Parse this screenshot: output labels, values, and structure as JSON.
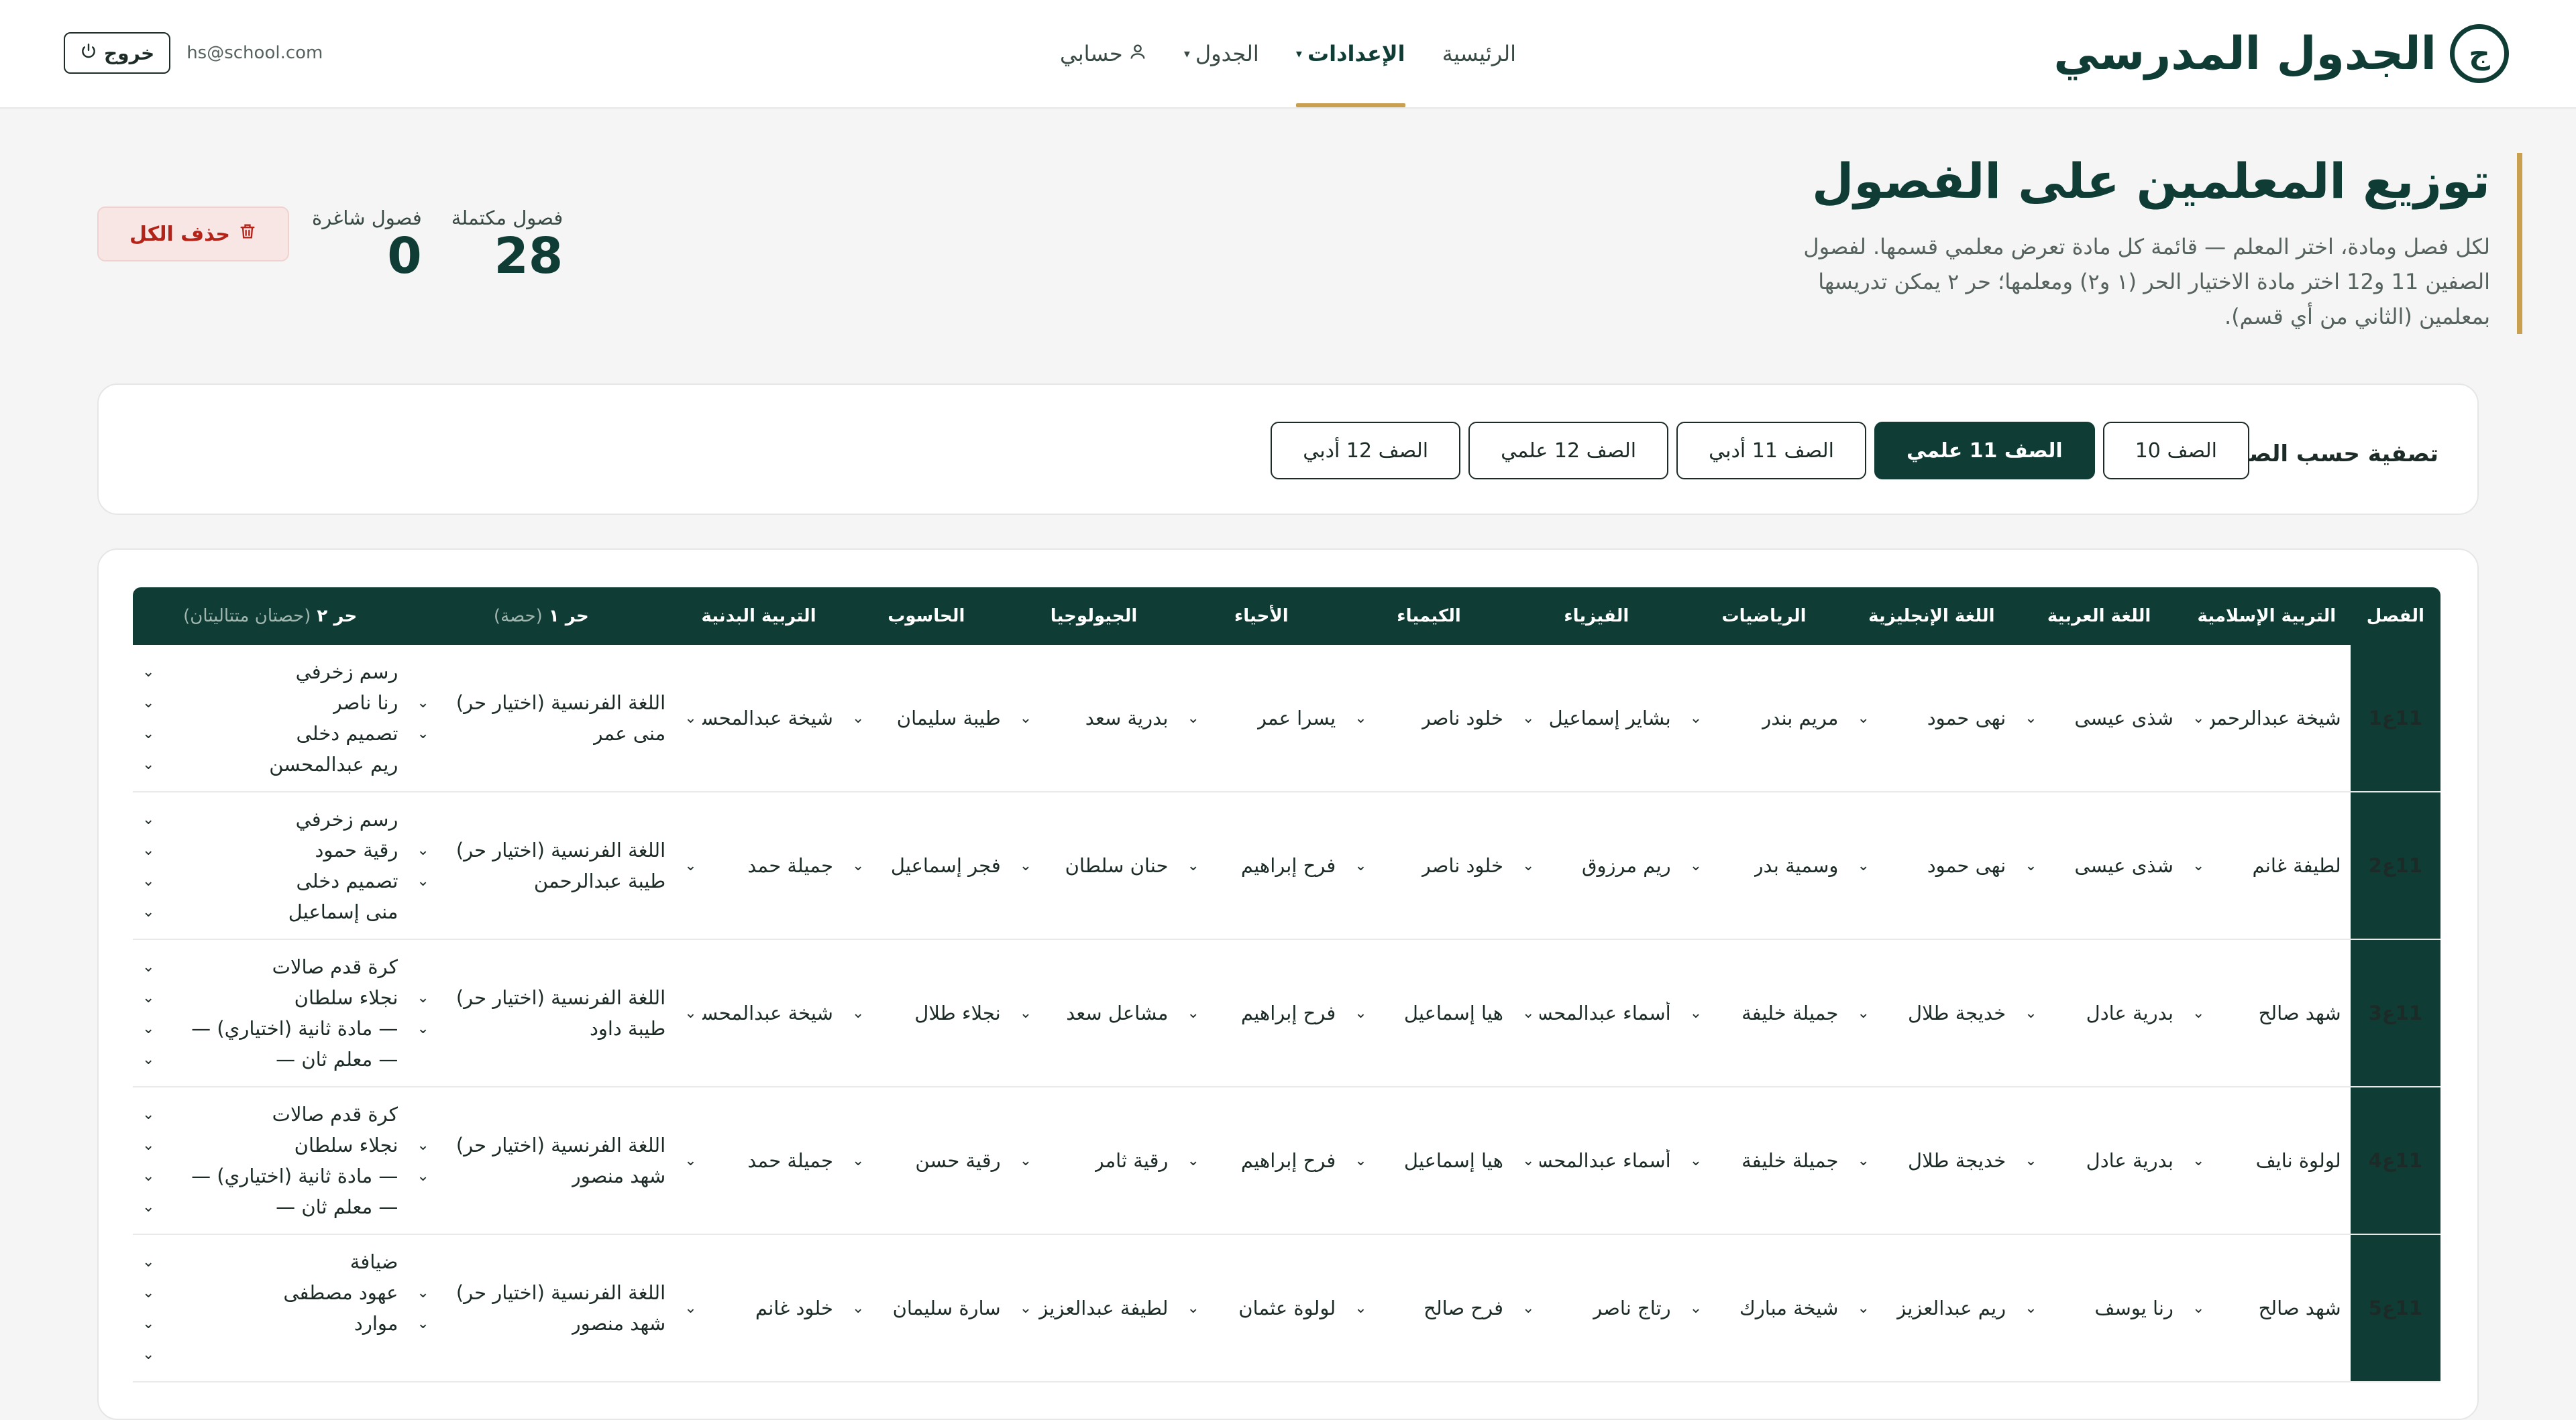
{
  "brand": {
    "logo_letter": "ج",
    "name": "الجدول المدرسي"
  },
  "nav": {
    "home": "الرئيسية",
    "settings": "الإعدادات",
    "schedule": "الجدول",
    "account": "حسابي"
  },
  "user": {
    "email": "hs@school.com",
    "logout": "خروج"
  },
  "page": {
    "title": "توزيع المعلمين على الفصول",
    "description": "لكل فصل ومادة، اختر المعلم — قائمة كل مادة تعرض معلمي قسمها. لفصول الصفين 11 و12 اختر مادة الاختيار الحر (١ و٢) ومعلمها؛ حر ٢ يمكن تدريسها بمعلمين (الثاني من أي قسم)."
  },
  "stats": {
    "completed_label": "فصول مكتملة",
    "completed_value": "28",
    "vacant_label": "فصول شاغرة",
    "vacant_value": "0",
    "delete_all": "حذف الكل"
  },
  "filter": {
    "label": "تصفية حسب الصف:",
    "grades": [
      "الصف 10",
      "الصف 11 علمي",
      "الصف 11 أدبي",
      "الصف 12 علمي",
      "الصف 12 أدبي"
    ],
    "active": "الصف 11 علمي"
  },
  "table": {
    "headers": [
      "الفصل",
      "التربية الإسلامية",
      "اللغة العربية",
      "اللغة الإنجليزية",
      "الرياضيات",
      "الفيزياء",
      "الكيمياء",
      "الأحياء",
      "الجيولوجيا",
      "الحاسوب",
      "التربية البدنية"
    ],
    "free1_header": "حر ١",
    "free1_note": "(حصة)",
    "free2_header": "حر ٢",
    "free2_note": "(حصتان متتاليتان)",
    "rows": [
      {
        "class": "11ع1",
        "teachers": [
          "شيخة عبدالرحمن",
          "شذى عيسى",
          "نهى حمود",
          "مريم بندر",
          "بشاير إسماعيل",
          "خلود ناصر",
          "يسرا عمر",
          "بدرية سعد",
          "طيبة سليمان",
          "شيخة عبدالمحسن"
        ],
        "free1": [
          "اللغة الفرنسية (اختيار حر)",
          "منى عمر"
        ],
        "free2": [
          "رسم زخرفي",
          "رنا ناصر",
          "تصميم دخلى",
          "ريم عبدالمحسن"
        ]
      },
      {
        "class": "11ع2",
        "teachers": [
          "لطيفة غانم",
          "شذى عيسى",
          "نهى حمود",
          "وسمية بدر",
          "ريم مرزوق",
          "خلود ناصر",
          "فرح إبراهيم",
          "حنان سلطان",
          "فجر إسماعيل",
          "جميلة حمد"
        ],
        "free1": [
          "اللغة الفرنسية (اختيار حر)",
          "طيبة عبدالرحمن"
        ],
        "free2": [
          "رسم زخرفي",
          "رقية حمود",
          "تصميم دخلى",
          "منى إسماعيل"
        ]
      },
      {
        "class": "11ع3",
        "teachers": [
          "شهد صالح",
          "بدرية عادل",
          "خديجة طلال",
          "جميلة خليفة",
          "أسماء عبدالمحسن",
          "هيا إسماعيل",
          "فرح إبراهيم",
          "مشاعل سعد",
          "نجلاء طلال",
          "شيخة عبدالمحسن"
        ],
        "free1": [
          "اللغة الفرنسية (اختيار حر)",
          "طيبة داود"
        ],
        "free2": [
          "كرة قدم صالات",
          "نجلاء سلطان",
          "— مادة ثانية (اختياري) —",
          "— معلم ثان —"
        ]
      },
      {
        "class": "11ع4",
        "teachers": [
          "لولوة نايف",
          "بدرية عادل",
          "خديجة طلال",
          "جميلة خليفة",
          "أسماء عبدالمحسن",
          "هيا إسماعيل",
          "فرح إبراهيم",
          "رقية ثامر",
          "رقية حسن",
          "جميلة حمد"
        ],
        "free1": [
          "اللغة الفرنسية (اختيار حر)",
          "شهد منصور"
        ],
        "free2": [
          "كرة قدم صالات",
          "نجلاء سلطان",
          "— مادة ثانية (اختياري) —",
          "— معلم ثان —"
        ]
      },
      {
        "class": "11ع5",
        "teachers": [
          "شهد صالح",
          "رنا يوسف",
          "ريم عبدالعزيز",
          "شيخة مبارك",
          "رتاج ناصر",
          "فرح صالح",
          "لولوة عثمان",
          "لطيفة عبدالعزيز",
          "سارة سليمان",
          "خلود غانم"
        ],
        "free1": [
          "اللغة الفرنسية (اختيار حر)",
          "شهد منصور"
        ],
        "free2": [
          "ضيافة",
          "عهود مصطفى",
          "موارد",
          ""
        ]
      }
    ]
  },
  "colors": {
    "primary": "#0f3d35",
    "accent": "#c8a050",
    "danger": "#b42318"
  },
  "icons": {
    "dropdown": "chevron-down-icon",
    "logout": "power-icon",
    "account": "user-icon",
    "delete": "trash-icon"
  }
}
